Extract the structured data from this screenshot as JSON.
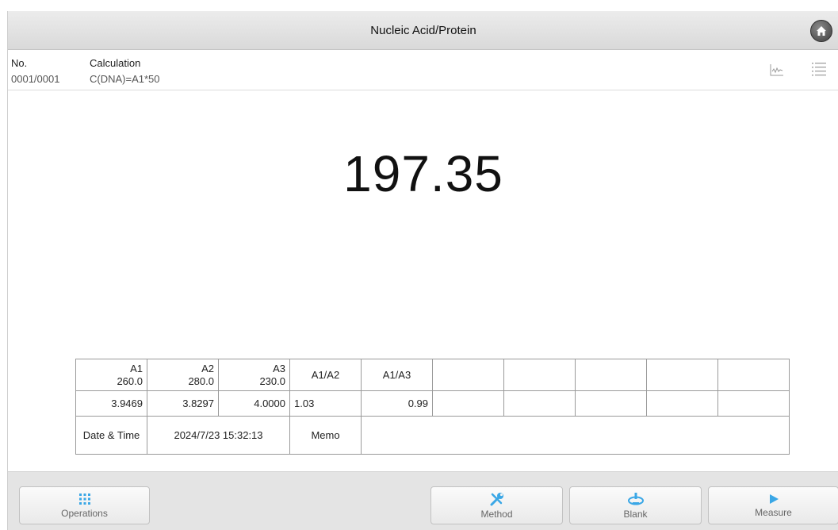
{
  "window": {
    "title": "Nucleic Acid/Protein"
  },
  "info": {
    "no_label": "No.",
    "no_value": "0001/0001",
    "calc_label": "Calculation",
    "calc_value": "C(DNA)=A1*50"
  },
  "result": {
    "value": "197.35"
  },
  "table": {
    "headers": [
      {
        "name": "A1",
        "wavelength": "260.0"
      },
      {
        "name": "A2",
        "wavelength": "280.0"
      },
      {
        "name": "A3",
        "wavelength": "230.0"
      }
    ],
    "ratio_headers": [
      "A1/A2",
      "A1/A3"
    ],
    "values": [
      "3.9469",
      "3.8297",
      "4.0000"
    ],
    "ratios": [
      "1.03",
      "0.99"
    ],
    "datetime_label": "Date & Time",
    "datetime_value": "2024/7/23 15:32:13",
    "memo_label": "Memo",
    "memo_value": ""
  },
  "buttons": {
    "operations": "Operations",
    "method": "Method",
    "blank": "Blank",
    "measure": "Measure"
  },
  "icons": {
    "home": "home-icon",
    "chart": "chart-icon",
    "list": "list-icon",
    "operations": "grid-dots-icon",
    "method": "tools-icon",
    "blank": "blank-icon",
    "measure": "play-icon"
  },
  "colors": {
    "accent": "#3aa7e6"
  }
}
